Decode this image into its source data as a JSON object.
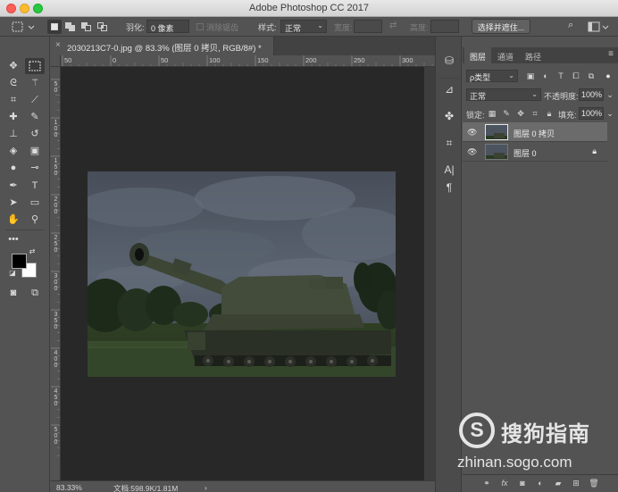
{
  "window": {
    "title": "Adobe Photoshop CC 2017"
  },
  "options_bar": {
    "feather_label": "羽化:",
    "feather_value": "0 像素",
    "antialias_label": "消除锯齿",
    "style_label": "样式:",
    "style_value": "正常",
    "width_label": "宽度:",
    "height_label": "高度:",
    "select_mask_button": "选择并遮住..."
  },
  "document": {
    "tab_title": "2030213C7-0.jpg @ 83.3% (图层 0 拷贝, RGB/8#) *",
    "ruler_h": [
      "50",
      "0",
      "50",
      "100",
      "150",
      "200",
      "250",
      "300",
      "350",
      "400",
      "450",
      "500",
      "550",
      "600",
      "650",
      "700",
      "750"
    ],
    "ruler_v": [
      "5 0",
      "1 0 0",
      "1 5 0",
      "2 0 0",
      "2 5 0",
      "3 0 0",
      "3 5 0",
      "4 0 0",
      "4 5 0",
      "5 0 0"
    ],
    "zoom": "83.33%",
    "doc_size": "文档:598.9K/1.81M",
    "nav_arrow": "›"
  },
  "layers_panel": {
    "tabs": [
      "图层",
      "通道",
      "路径"
    ],
    "filter_kind": "ρ类型",
    "blend_mode": "正常",
    "opacity_label": "不透明度:",
    "opacity_value": "100%",
    "lock_label": "锁定:",
    "fill_label": "填充:",
    "fill_value": "100%",
    "layers": [
      {
        "name": "图层 0 拷贝",
        "selected": true,
        "locked": false
      },
      {
        "name": "图层 0",
        "selected": false,
        "locked": true
      }
    ],
    "bottom_fx": "fx"
  },
  "watermark": {
    "logo_letter": "S",
    "brand": "搜狗指南",
    "url": "zhinan.sogo.com"
  },
  "colors": {
    "foreground": "#000000",
    "background": "#ffffff",
    "ui_dark": "#535353",
    "canvas_bg": "#282828"
  },
  "icons": {
    "toolbox": [
      "move-icon",
      "marquee-icon",
      "lasso-icon",
      "magic-wand-icon",
      "crop-icon",
      "eyedropper-icon",
      "healing-brush-icon",
      "brush-icon",
      "clone-stamp-icon",
      "history-brush-icon",
      "eraser-icon",
      "gradient-icon",
      "blur-icon",
      "dodge-icon",
      "pen-icon",
      "type-icon",
      "path-select-icon",
      "rectangle-icon",
      "hand-icon",
      "zoom-icon",
      "more-tools-icon",
      "quick-mask-icon",
      "screen-mode-icon"
    ],
    "middle_strip": [
      "libraries-icon",
      "properties-icon",
      "adjustments-icon",
      "crop-panel-icon",
      "character-icon",
      "paragraph-icon"
    ]
  }
}
